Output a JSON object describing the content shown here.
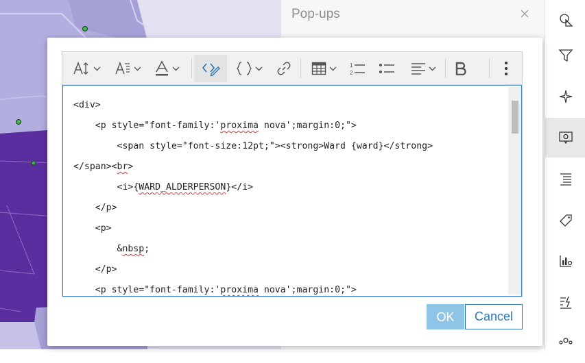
{
  "panel": {
    "title": "Pop-ups",
    "close_icon": "close-icon"
  },
  "right_toolbar": {
    "items": [
      "shapes-icon",
      "filter-icon",
      "sparkle-icon",
      "popup-config-icon",
      "list-settings-icon",
      "label-tag-icon",
      "chart-settings-icon",
      "field-effects-icon",
      "group-icon"
    ],
    "active": "popup-config-icon"
  },
  "editor": {
    "toolbar": [
      "font-size-icon",
      "heading-icon",
      "font-color-icon",
      "source-edit-icon",
      "insert-expression-icon",
      "link-icon",
      "table-icon",
      "numbered-list-icon",
      "bulleted-list-icon",
      "align-icon",
      "bold-icon",
      "more-icon"
    ],
    "code_lines": [
      "<div>",
      "    <p style=\"font-family:'proxima nova';margin:0;\">",
      "        <span style=\"font-size:12pt;\"><strong>Ward {ward}</strong>",
      "</span><br>",
      "        <i>{WARD_ALDERPERSON}</i>",
      "    </p>",
      "    <p>",
      "        &nbsp;",
      "    </p>",
      "    <p style=\"font-family:'proxima nova';margin:0;\">"
    ]
  },
  "buttons": {
    "ok": "OK",
    "cancel": "Cancel"
  },
  "colors": {
    "accent": "#2a78b8",
    "ok_bg": "#8ec4e6",
    "map_purple_dark": "#5a2f9f",
    "map_purple_light": "#a9a4d8"
  }
}
